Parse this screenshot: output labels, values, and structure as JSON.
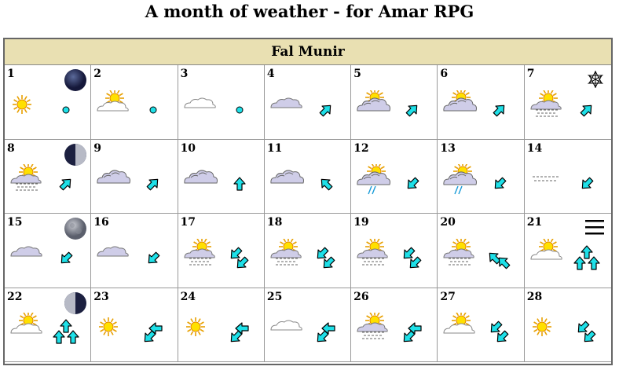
{
  "page": {
    "title": "A month of weather - for Amar RPG"
  },
  "calendar": {
    "month": "Fal Munir",
    "days": [
      {
        "n": "1",
        "moon": "new",
        "cross": "",
        "wx": "sun",
        "wind": "calm"
      },
      {
        "n": "2",
        "moon": "",
        "cross": "",
        "wx": "sun-cloud",
        "wind": "calm"
      },
      {
        "n": "3",
        "moon": "",
        "cross": "",
        "wx": "cloud-light",
        "wind": "calm"
      },
      {
        "n": "4",
        "moon": "",
        "cross": "",
        "wx": "cloud",
        "wind": "ne"
      },
      {
        "n": "5",
        "moon": "",
        "cross": "",
        "wx": "sun-cloud-dense",
        "wind": "ne"
      },
      {
        "n": "6",
        "moon": "",
        "cross": "",
        "wx": "sun-cloud-dense",
        "wind": "ne"
      },
      {
        "n": "7",
        "moon": "",
        "cross": "star",
        "wx": "sun-fog",
        "wind": "ne"
      },
      {
        "n": "8",
        "moon": "first-quarter",
        "cross": "",
        "wx": "sun-fog",
        "wind": "ne"
      },
      {
        "n": "9",
        "moon": "",
        "cross": "",
        "wx": "cloud-dense",
        "wind": "ne"
      },
      {
        "n": "10",
        "moon": "",
        "cross": "",
        "wx": "cloud-dense",
        "wind": "n"
      },
      {
        "n": "11",
        "moon": "",
        "cross": "",
        "wx": "cloud-dense",
        "wind": "nw"
      },
      {
        "n": "12",
        "moon": "",
        "cross": "",
        "wx": "sun-rain",
        "wind": "sw"
      },
      {
        "n": "13",
        "moon": "",
        "cross": "",
        "wx": "sun-rain",
        "wind": "sw"
      },
      {
        "n": "14",
        "moon": "",
        "cross": "",
        "wx": "fog",
        "wind": "sw"
      },
      {
        "n": "15",
        "moon": "full",
        "cross": "",
        "wx": "cloud",
        "wind": "sw"
      },
      {
        "n": "16",
        "moon": "",
        "cross": "",
        "wx": "cloud",
        "wind": "sw"
      },
      {
        "n": "17",
        "moon": "",
        "cross": "",
        "wx": "sun-fog",
        "wind": "sw2"
      },
      {
        "n": "18",
        "moon": "",
        "cross": "",
        "wx": "sun-fog",
        "wind": "sw2"
      },
      {
        "n": "19",
        "moon": "",
        "cross": "",
        "wx": "sun-fog",
        "wind": "sw2"
      },
      {
        "n": "20",
        "moon": "",
        "cross": "",
        "wx": "sun-fog",
        "wind": "nw2"
      },
      {
        "n": "21",
        "moon": "",
        "cross": "menu",
        "wx": "sun-cloud",
        "wind": "n3"
      },
      {
        "n": "22",
        "moon": "last-quarter",
        "cross": "",
        "wx": "sun-cloud",
        "wind": "n3"
      },
      {
        "n": "23",
        "moon": "",
        "cross": "",
        "wx": "sun",
        "wind": "w2"
      },
      {
        "n": "24",
        "moon": "",
        "cross": "",
        "wx": "sun",
        "wind": "w2"
      },
      {
        "n": "25",
        "moon": "",
        "cross": "",
        "wx": "cloud-light",
        "wind": "w2"
      },
      {
        "n": "26",
        "moon": "",
        "cross": "",
        "wx": "sun-fog",
        "wind": "w2"
      },
      {
        "n": "27",
        "moon": "",
        "cross": "",
        "wx": "sun-cloud",
        "wind": "sw2"
      },
      {
        "n": "28",
        "moon": "",
        "cross": "",
        "wx": "sun",
        "wind": "sw2"
      }
    ]
  }
}
